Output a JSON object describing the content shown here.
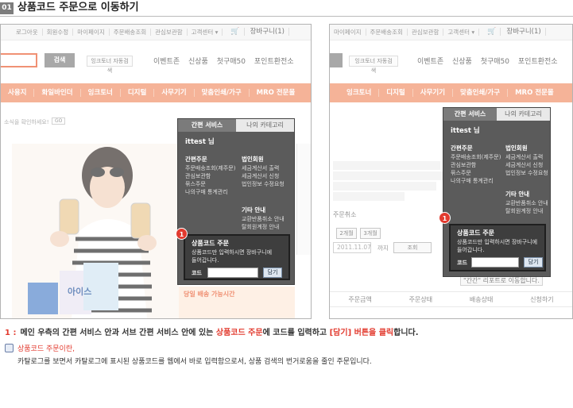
{
  "header": {
    "step": "01",
    "title": "상품코드 주문으로 이동하기"
  },
  "shot1": {
    "topnav": [
      "로그아웃",
      "회원수정",
      "마이페이지",
      "주문배송조회",
      "관심보관함",
      "고객센터 ▾"
    ],
    "cart": "장바구니(1)",
    "search_button": "검색",
    "inktoner_button": "잉크토너 자동검색",
    "promos": [
      "이벤트존",
      "신상품",
      "첫구매50",
      "포인트환전소"
    ],
    "categories": [
      "사용지",
      "화일바인더",
      "잉크토너",
      "디지털",
      "사무기기",
      "맞춤인쇄/가구",
      "MRO 전문몰"
    ],
    "notice": "소식을 확인하세요!",
    "go": "GO",
    "delivery_title": "당일 배송 가능시간"
  },
  "panel": {
    "tab_active": "간편 서비스",
    "tab_inactive": "나의 카테고리",
    "user": "ittest 님",
    "col1_title": "간편주문",
    "col1_items": [
      "주문배송조회(제주문)",
      "관심보관함",
      "묶스주문",
      "나의구매 통계관리"
    ],
    "col2_title": "법인회원",
    "col2_items": [
      "세금계산서 출력",
      "세금계산서 신청",
      "법인정보 수정요청"
    ],
    "col3_title": "기타 안내",
    "col3_items": [
      "교환반품취소 안내",
      "탈회원계정 안내"
    ],
    "code_title": "상품코드 주문",
    "code_desc_1": "상품코드만 입력하시면 장바구니에",
    "code_desc_2": "들어갑니다.",
    "code_label": "코드",
    "code_button": "담기",
    "badge": "1"
  },
  "shot2": {
    "topnav": [
      "마이페이지",
      "주문배송조회",
      "관심보관함",
      "고객센터 ▾"
    ],
    "cart": "장바구니(1)",
    "inktoner_button": "잉크토너 자동검색",
    "promos": [
      "이벤트존",
      "신상품",
      "첫구매50",
      "포인트환전소"
    ],
    "categories": [
      "잉크토너",
      "디지털",
      "사무기기",
      "맞춤인쇄/가구",
      "MRO 전문몰"
    ],
    "period_buttons": [
      "2개월",
      "3개월"
    ],
    "date_value": "2011.11.07",
    "date_suffix": "까지",
    "lookup_button": "조회",
    "cancel_text": "주문취소",
    "columns": [
      "주문금액",
      "주문상태",
      "배송상태",
      "신청하기"
    ],
    "review_text": "\"간간\" 리포트로 이동합니다."
  },
  "instruction": {
    "num": "1 :",
    "part1": "메인 우측의 간편 서비스 안과 서브 간편 서비스 안에 있는 ",
    "highlight1": "상품코드 주문",
    "part2": "에 코드를 입력하고 ",
    "highlight2": "[담기] 버튼을 클릭",
    "part3": "합니다."
  },
  "info": {
    "heading": "상품코드 주문이란,",
    "body": "카탈로그를 보면서 카탈로그에 표시된 상품코드를 웹에서 바로 입력함으로서, 상품 검색의 번거로움을 줄인 주문입니다."
  },
  "colors": {
    "accent_orange": "#f08a62",
    "badge_red": "#e23a2e",
    "panel_gray": "#5b5b5b"
  }
}
